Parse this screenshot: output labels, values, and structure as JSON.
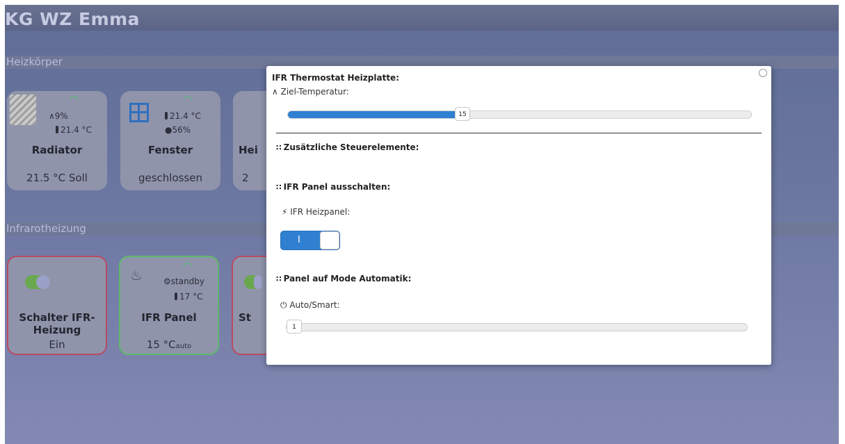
{
  "app": {
    "title": "KG WZ Emma"
  },
  "sections": {
    "heizkoerper": "Heizkörper",
    "infrarot": "Infrarotheizung"
  },
  "tiles_heiz": [
    {
      "title": "Radiator",
      "valve": "9%",
      "temp": "21.4 °C",
      "foot": "21.5 °C Soll"
    },
    {
      "title": "Fenster",
      "temp": "21.4 °C",
      "humidity": "56%",
      "foot": "geschlossen"
    },
    {
      "title": "Hei",
      "foot": "2"
    }
  ],
  "tiles_ifr": [
    {
      "title": "Schalter IFR-Heizung",
      "foot": "Ein"
    },
    {
      "title": "IFR Panel",
      "status": "standby",
      "temp": "17 °C",
      "foot_value": "15 °C",
      "foot_mode": "auto"
    },
    {
      "title": "St"
    }
  ],
  "modal": {
    "title": "IFR Thermostat Heizplatte:",
    "target_label": "Ziel-Temperatur:",
    "target_value": "15",
    "target_fraction": 0.36,
    "extra_controls": "Zusätzliche Steuerelemente:",
    "panel_off_section": "IFR Panel ausschalten:",
    "panel_label": "IFR Heizpanel:",
    "toggle_on_text": "I",
    "auto_section": "Panel auf Mode Automatik:",
    "auto_label": "Auto/Smart:",
    "auto_value": "1",
    "auto_fraction": 0.0
  },
  "colors": {
    "accent": "#2f80d0",
    "wifi": "#4fc46a",
    "switch_on": "#6aa84f"
  },
  "icons": [
    "wifi-icon",
    "thermometer-icon",
    "drop-icon",
    "gauge-icon",
    "window-icon",
    "bolt-icon",
    "power-icon",
    "grid-icon",
    "clock-icon",
    "gear-icon",
    "heat-waves-icon"
  ]
}
